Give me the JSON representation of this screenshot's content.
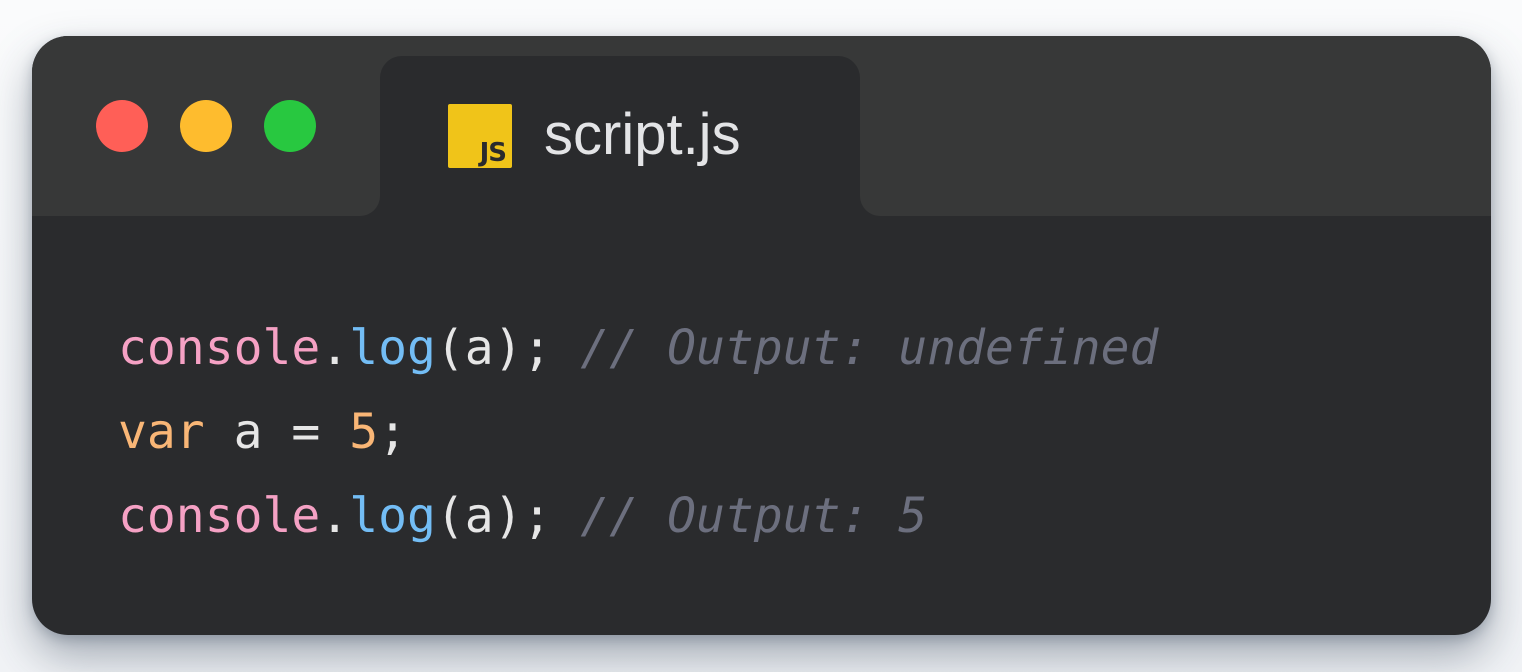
{
  "window": {
    "controls": [
      {
        "name": "close",
        "color": "#ff5f57"
      },
      {
        "name": "minimize",
        "color": "#febc2e"
      },
      {
        "name": "zoom",
        "color": "#28c840"
      }
    ]
  },
  "tab": {
    "icon": "javascript-file-icon",
    "icon_text": "JS",
    "title": "script.js"
  },
  "colors": {
    "identifier": "#f5a1c4",
    "method": "#73bdf5",
    "keyword": "#f9b676",
    "number": "#f9b676",
    "plain": "#e6e6e6",
    "comment": "#6c6f7e"
  },
  "code": {
    "lines": [
      [
        {
          "text": "console",
          "kind": "identifier"
        },
        {
          "text": ".",
          "kind": "plain"
        },
        {
          "text": "log",
          "kind": "method"
        },
        {
          "text": "(a); ",
          "kind": "plain"
        },
        {
          "text": "// Output: undefined",
          "kind": "comment"
        }
      ],
      [
        {
          "text": "var",
          "kind": "keyword"
        },
        {
          "text": " a = ",
          "kind": "plain"
        },
        {
          "text": "5",
          "kind": "number"
        },
        {
          "text": ";",
          "kind": "plain"
        }
      ],
      [
        {
          "text": "console",
          "kind": "identifier"
        },
        {
          "text": ".",
          "kind": "plain"
        },
        {
          "text": "log",
          "kind": "method"
        },
        {
          "text": "(a); ",
          "kind": "plain"
        },
        {
          "text": "// Output: 5",
          "kind": "comment"
        }
      ]
    ]
  }
}
